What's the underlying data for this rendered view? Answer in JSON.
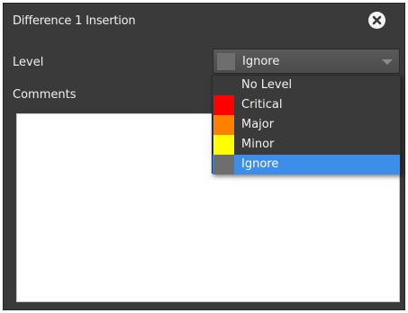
{
  "dialog": {
    "title": "Difference 1 Insertion",
    "close_icon": "close-circle-x-icon"
  },
  "level": {
    "label": "Level",
    "selected_value": "Ignore",
    "selected_color": "#6e6e6e",
    "caret_icon": "chevron-down-icon"
  },
  "dropdown": {
    "options": [
      {
        "label": "No Level",
        "color": "",
        "selected": false
      },
      {
        "label": "Critical",
        "color": "#ff0000",
        "selected": false
      },
      {
        "label": "Major",
        "color": "#ff7f00",
        "selected": false
      },
      {
        "label": "Minor",
        "color": "#ffff00",
        "selected": false
      },
      {
        "label": "Ignore",
        "color": "#6e6e6e",
        "selected": true
      }
    ],
    "highlight_color": "#3c8ee8"
  },
  "comments": {
    "label": "Comments",
    "value": ""
  }
}
